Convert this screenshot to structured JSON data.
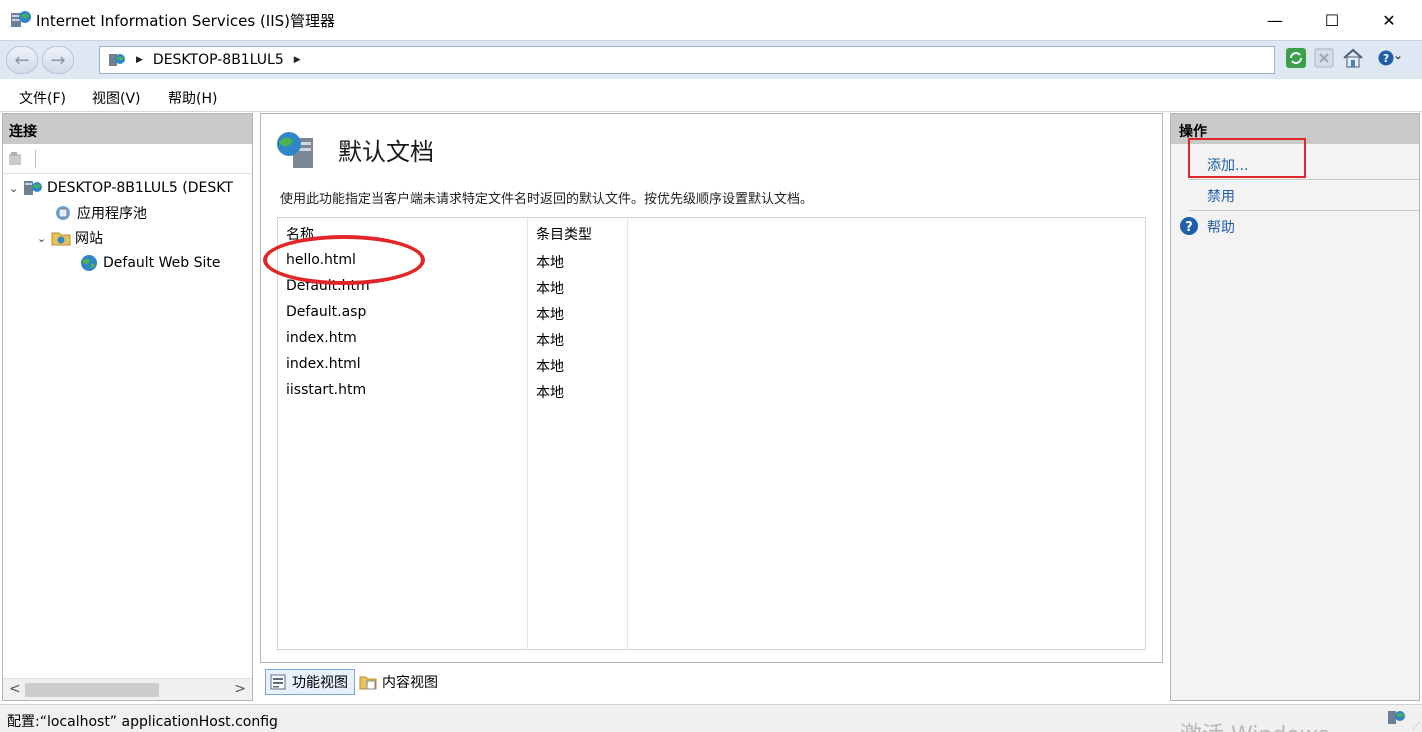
{
  "window": {
    "title": "Internet Information Services (IIS)管理器",
    "app_icon": "iis-manager-icon",
    "controls": {
      "minimize": "—",
      "maximize": "☐",
      "close": "✕"
    }
  },
  "navigation": {
    "back_glyph": "←",
    "forward_glyph": "→",
    "breadcrumb_separator": "▶",
    "breadcrumb": [
      "DESKTOP-8B1LUL5"
    ],
    "toolbar_icons": [
      "refresh-icon",
      "stop-icon",
      "home-icon",
      "help-icon"
    ]
  },
  "menu": {
    "items": [
      "文件(F)",
      "视图(V)",
      "帮助(H)"
    ]
  },
  "connections": {
    "header": "连接",
    "tree": [
      {
        "label": "DESKTOP-8B1LUL5 (DESKT",
        "expander": "⌄",
        "icon": "server-icon"
      },
      {
        "label": "应用程序池",
        "expander": "",
        "icon": "app-pool-icon"
      },
      {
        "label": "网站",
        "expander": "⌄",
        "icon": "sites-folder-icon"
      },
      {
        "label": "Default Web Site",
        "expander": "",
        "icon": "globe-icon"
      }
    ],
    "scroll_left": "<",
    "scroll_right": ">"
  },
  "main": {
    "title": "默认文档",
    "description": "使用此功能指定当客户端未请求特定文件名时返回的默认文件。按优先级顺序设置默认文档。",
    "columns": [
      "名称",
      "条目类型"
    ],
    "rows": [
      {
        "name": "hello.html",
        "type": "本地"
      },
      {
        "name": "Default.htm",
        "type": "本地"
      },
      {
        "name": "Default.asp",
        "type": "本地"
      },
      {
        "name": "index.htm",
        "type": "本地"
      },
      {
        "name": "index.html",
        "type": "本地"
      },
      {
        "name": "iisstart.htm",
        "type": "本地"
      }
    ],
    "view_tabs": [
      {
        "label": "功能视图",
        "active": true
      },
      {
        "label": "内容视图",
        "active": false
      }
    ]
  },
  "actions": {
    "header": "操作",
    "items": [
      {
        "label": "添加..."
      },
      {
        "label": "禁用"
      },
      {
        "label": "帮助"
      }
    ]
  },
  "status": {
    "text": "配置:“localhost” applicationHost.config",
    "watermark": "激活 Windows"
  },
  "colors": {
    "annotation": "#e0262a",
    "link": "#1f5fa8",
    "panel_header": "#c9c9c9",
    "address_bar_bg": "#dfe7f2"
  }
}
